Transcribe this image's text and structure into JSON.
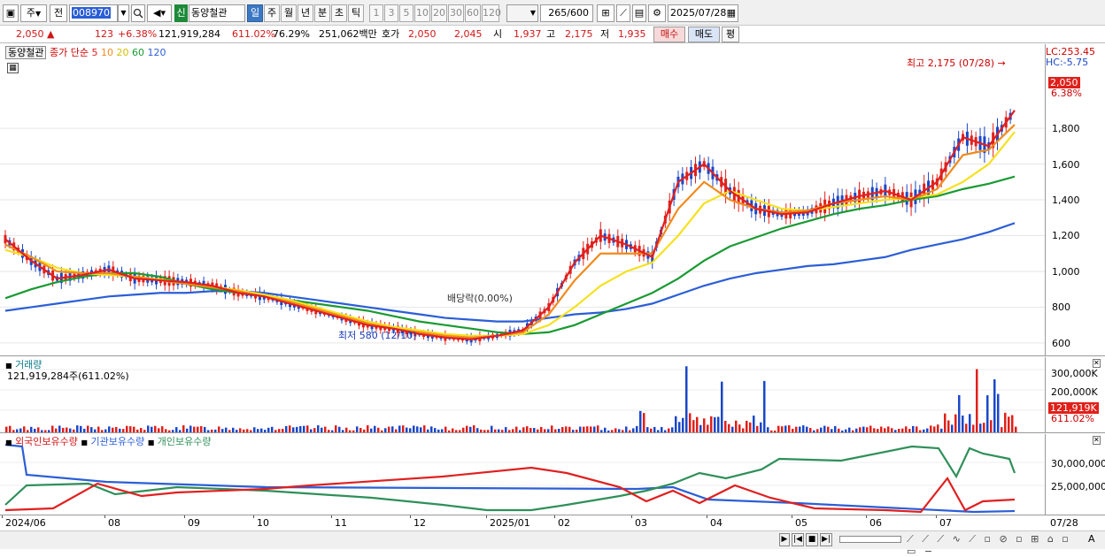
{
  "toolbar": {
    "type_label": "주",
    "prev_label": "전",
    "code_value": "008970",
    "badge": "신",
    "name_value": "동양철관",
    "periods": [
      "일",
      "주",
      "월",
      "년",
      "분",
      "초",
      "틱"
    ],
    "numbers": [
      "1",
      "3",
      "5",
      "10",
      "20",
      "30",
      "60",
      "120"
    ],
    "count_label": "265",
    "count_total": "/600",
    "date_value": "2025/07/28"
  },
  "status": {
    "price": "2,050",
    "change": "123",
    "change_pct": "+6.38%",
    "volume": "121,919,284",
    "vol_ratio": "611.02%",
    "turnover": "76.29%",
    "amount": "251,062백만",
    "quote_label": "호가",
    "ask": "2,050",
    "bid": "2,045",
    "open_label": "시",
    "open": "1,937",
    "high_label": "고",
    "high": "2,175",
    "low_label": "저",
    "low": "1,935",
    "buy_label": "매수",
    "sell_label": "매도",
    "flat_label": "평"
  },
  "price_chart": {
    "stock_tag": "동양철관",
    "ma_header": "종가 단순",
    "ma_periods": [
      "5",
      "10",
      "20",
      "60",
      "120"
    ],
    "lc": "LC:253.45",
    "hc": "HC:-5.75",
    "high_note": "최고 2,175 (07/28)",
    "low_note": "최저 580 (12/10)",
    "div_note": "배당락(0.00%)",
    "last_price": "2,050",
    "last_pct": "6.38%",
    "y_ticks": [
      "1,800",
      "1,600",
      "1,400",
      "1,200",
      "1,000",
      "800",
      "600"
    ]
  },
  "volume_chart": {
    "title": "거래량",
    "value": "121,919,284주(611.02%)",
    "y_ticks": [
      "300,000K",
      "200,000K",
      "100,000K"
    ],
    "last_value": "121,919K",
    "last_pct": "611.02%"
  },
  "holding_chart": {
    "legend": [
      "외국인보유수량",
      "기관보유수량",
      "개인보유수량"
    ],
    "y_ticks": [
      "30,000,000",
      "25,000,000"
    ]
  },
  "x_axis": [
    "2024/06",
    "08",
    "09",
    "10",
    "11",
    "12",
    "2025/01",
    "02",
    "03",
    "04",
    "05",
    "06",
    "07"
  ],
  "x_last": "07/28",
  "colors": {
    "up": "#e0201a",
    "down": "#1a47c8",
    "ma5": "#e02020",
    "ma10": "#f08a1c",
    "ma20": "#f5e11e",
    "ma60": "#199a32",
    "ma120": "#2b5ed6",
    "foreign": "#e02020",
    "institution": "#2b5ed6",
    "individual": "#2f8f5a"
  },
  "chart_data": {
    "type": "candlestick",
    "x_start": "2024/06",
    "x_end": "2025/07/28",
    "ylim": [
      560,
      2250
    ],
    "ma_close": [
      [
        1180,
        1060,
        960,
        980,
        1010,
        960,
        950,
        940,
        920,
        880,
        860,
        820,
        780,
        740,
        700,
        680,
        650,
        630,
        620,
        640,
        670,
        800,
        1050,
        1200,
        1150,
        1080,
        1500,
        1600,
        1450,
        1350,
        1320,
        1330,
        1380,
        1420,
        1450,
        1400,
        1500,
        1750,
        1700,
        1900
      ],
      [
        1150,
        1080,
        1000,
        990,
        990,
        970,
        950,
        930,
        910,
        890,
        860,
        830,
        790,
        750,
        710,
        680,
        660,
        640,
        630,
        640,
        660,
        760,
        950,
        1100,
        1100,
        1100,
        1350,
        1500,
        1400,
        1350,
        1330,
        1340,
        1380,
        1400,
        1420,
        1400,
        1460,
        1650,
        1680,
        1820
      ],
      [
        1120,
        1080,
        1020,
        990,
        980,
        970,
        955,
        935,
        915,
        895,
        870,
        840,
        800,
        760,
        720,
        690,
        670,
        650,
        640,
        640,
        650,
        700,
        800,
        920,
        1000,
        1050,
        1200,
        1380,
        1450,
        1400,
        1350,
        1340,
        1360,
        1380,
        1400,
        1410,
        1430,
        1500,
        1600,
        1780
      ],
      [
        850,
        900,
        940,
        970,
        990,
        990,
        970,
        930,
        900,
        880,
        860,
        840,
        820,
        800,
        780,
        750,
        720,
        700,
        680,
        660,
        650,
        660,
        700,
        760,
        820,
        880,
        960,
        1060,
        1140,
        1190,
        1240,
        1280,
        1320,
        1350,
        1370,
        1400,
        1420,
        1460,
        1490,
        1530
      ],
      [
        780,
        800,
        820,
        840,
        860,
        870,
        880,
        880,
        890,
        890,
        880,
        860,
        840,
        820,
        800,
        780,
        760,
        740,
        730,
        720,
        720,
        740,
        760,
        770,
        790,
        820,
        870,
        920,
        960,
        990,
        1010,
        1030,
        1040,
        1060,
        1080,
        1120,
        1150,
        1180,
        1220,
        1270
      ]
    ]
  }
}
